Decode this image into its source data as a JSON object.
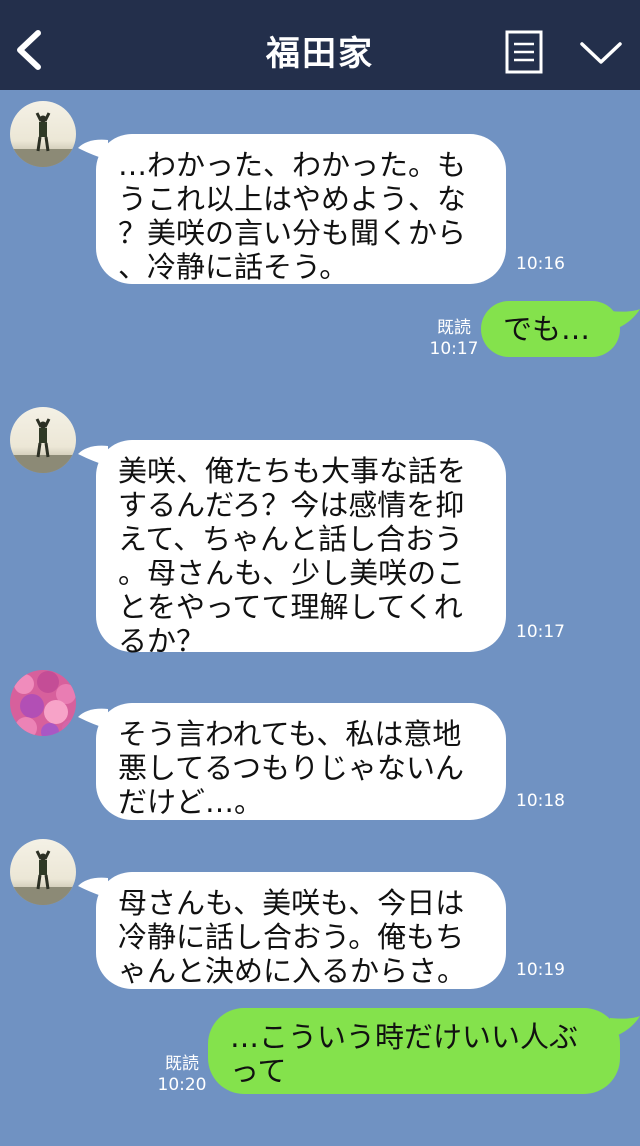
{
  "header": {
    "title": "福田家",
    "back_icon": "chevron-left-icon",
    "menu_icon": "notes-icon",
    "expand_icon": "chevron-down-icon"
  },
  "colors": {
    "background": "#7092c2",
    "header": "#232f4b",
    "incoming_bubble": "#ffffff",
    "outgoing_bubble": "#84e24c"
  },
  "messages": [
    {
      "side": "in",
      "avatar": "man-silhouette-avatar",
      "text": "…わかった、わかった。も\nうこれ以上はやめよう、な\n？美咲の言い分も聞くから\n、冷静に話そう。",
      "time": "10:16"
    },
    {
      "side": "out",
      "text": "でも…",
      "read": "既読",
      "time": "10:17"
    },
    {
      "side": "in",
      "avatar": "man-silhouette-avatar",
      "text": "美咲、俺たちも大事な話を\nするんだろ？今は感情を抑\nえて、ちゃんと話し合おう\n。母さんも、少し美咲のこ\nとをやってて理解してくれ\nるか？",
      "time": "10:17"
    },
    {
      "side": "in",
      "avatar": "flower-avatar",
      "text": "そう言われても、私は意地\n悪してるつもりじゃないん\nだけど…。",
      "time": "10:18"
    },
    {
      "side": "in",
      "avatar": "man-silhouette-avatar",
      "text": "母さんも、美咲も、今日は\n冷静に話し合おう。俺もち\nゃんと決めに入るからさ。",
      "time": "10:19"
    },
    {
      "side": "out",
      "text": "…こういう時だけいい人ぶ\nって",
      "read": "既読",
      "time": "10:20"
    }
  ]
}
